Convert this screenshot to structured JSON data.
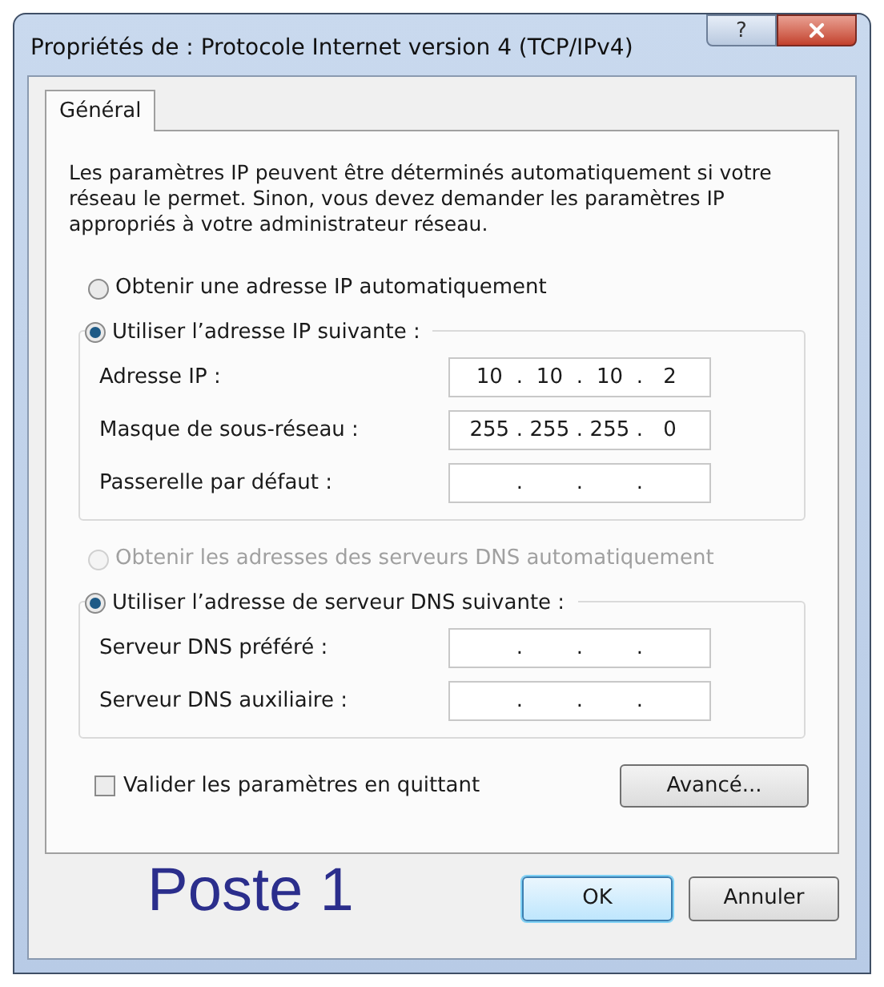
{
  "window": {
    "title": "Propriétés de : Protocole Internet version 4 (TCP/IPv4)",
    "help": "?"
  },
  "tabs": [
    {
      "label": "Général",
      "selected": true
    }
  ],
  "intro": "Les paramètres IP peuvent être déterminés automatiquement si votre réseau le permet. Sinon, vous devez demander les paramètres IP appropriés à votre administrateur réseau.",
  "sections": [
    {
      "auto": {
        "label": "Obtenir une adresse IP automatiquement",
        "selected": false,
        "disabled": false
      },
      "manual": {
        "label": "Utiliser l’adresse IP suivante :",
        "selected": true,
        "disabled": false
      },
      "fields": [
        {
          "label": "Adresse IP :",
          "octets": [
            "10",
            "10",
            "10",
            "2"
          ],
          "dots": [
            ".",
            ".",
            "."
          ]
        },
        {
          "label": "Masque de sous-réseau :",
          "octets": [
            "255",
            "255",
            "255",
            "0"
          ],
          "dots": [
            ".",
            ".",
            "."
          ]
        },
        {
          "label": "Passerelle par défaut :",
          "dots": [
            ".",
            ".",
            "."
          ]
        }
      ]
    },
    {
      "auto": {
        "label": "Obtenir les adresses des serveurs DNS automatiquement",
        "selected": false,
        "disabled": true
      },
      "manual": {
        "label": "Utiliser l’adresse de serveur DNS suivante :",
        "selected": true,
        "disabled": false
      },
      "fields": [
        {
          "label": "Serveur DNS préféré :",
          "dots": [
            ".",
            ".",
            "."
          ]
        },
        {
          "label": "Serveur DNS auxiliaire :",
          "dots": [
            ".",
            ".",
            "."
          ]
        }
      ]
    }
  ],
  "validate": {
    "label": "Valider les paramètres en quittant",
    "checked": false
  },
  "advanced_button": "Avancé...",
  "annotation": "Poste 1",
  "buttons": [
    {
      "label": "OK",
      "default": true
    },
    {
      "label": "Annuler",
      "default": false
    }
  ]
}
